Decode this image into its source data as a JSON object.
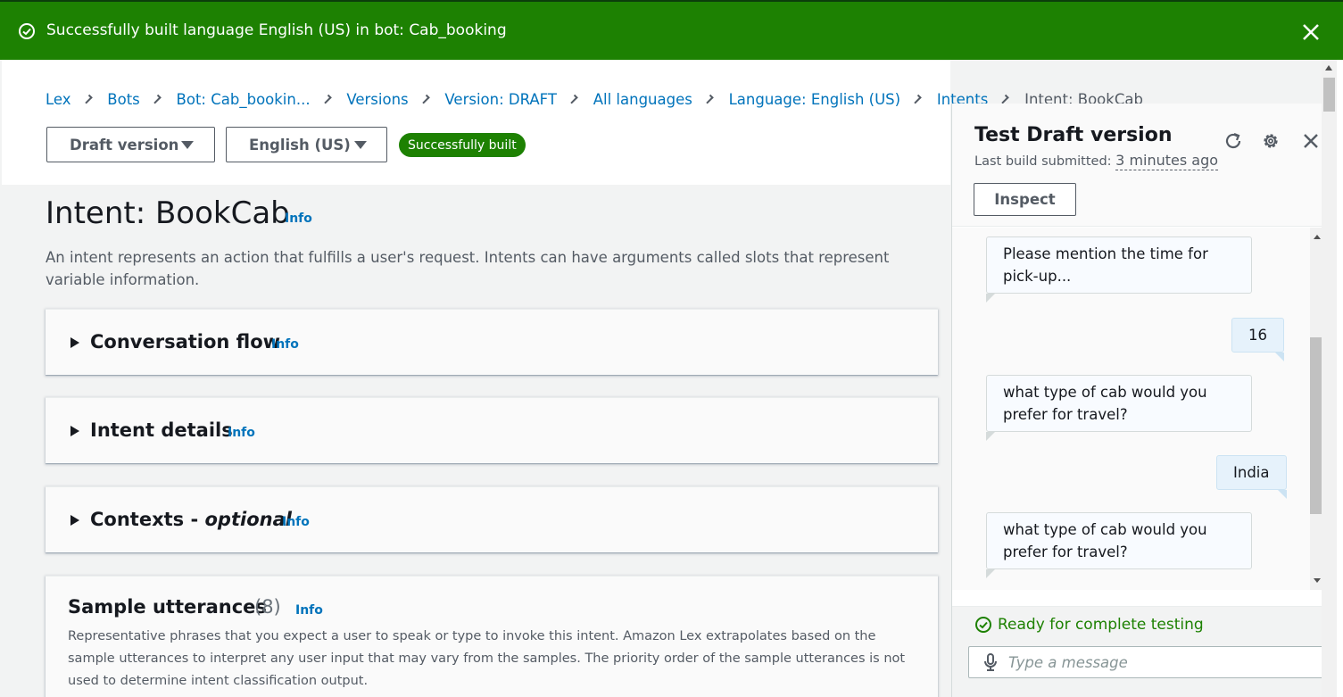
{
  "flash": {
    "message": "Successfully built language English (US) in bot: Cab_booking",
    "status_color": "#1d8102"
  },
  "breadcrumbs": [
    "Lex",
    "Bots",
    "Bot: Cab_bookin...",
    "Versions",
    "Version: DRAFT",
    "All languages",
    "Language: English (US)",
    "Intents",
    "Intent: BookCab"
  ],
  "header": {
    "version_dropdown": "Draft version",
    "language_dropdown": "English (US)",
    "build_badge": "Successfully built"
  },
  "intent": {
    "title": "Intent: BookCab",
    "info_label": "Info",
    "description": "An intent represents an action that fulfills a user's request. Intents can have arguments called slots that represent variable information."
  },
  "sections": [
    {
      "title": "Conversation flow",
      "info": "Info"
    },
    {
      "title": "Intent details",
      "info": "Info"
    },
    {
      "title_prefix": "Contexts - ",
      "title_em": "optional",
      "info": "Info"
    }
  ],
  "sample_utterances": {
    "title": "Sample utterances",
    "count": "(8)",
    "info": "Info",
    "description": "Representative phrases that you expect a user to speak or type to invoke this intent. Amazon Lex extrapolates based on the sample utterances to interpret any user input that may vary from the samples. The priority order of the sample utterances is not used to determine intent classification output."
  },
  "test_panel": {
    "title": "Test Draft version",
    "last_build_label": "Last build submitted:",
    "last_build_time": "3 minutes ago",
    "inspect_label": "Inspect",
    "icons": [
      "refresh-icon",
      "gear-icon",
      "close-icon"
    ],
    "messages": [
      {
        "from": "bot",
        "text": "Please mention the time for pick-up..."
      },
      {
        "from": "user",
        "text": "16"
      },
      {
        "from": "bot",
        "text": "what type of cab would you prefer for travel?"
      },
      {
        "from": "user",
        "text": "India"
      },
      {
        "from": "bot",
        "text": "what type of cab would you prefer for travel?"
      }
    ],
    "status": "Ready for complete testing",
    "input_placeholder": "Type a message"
  }
}
